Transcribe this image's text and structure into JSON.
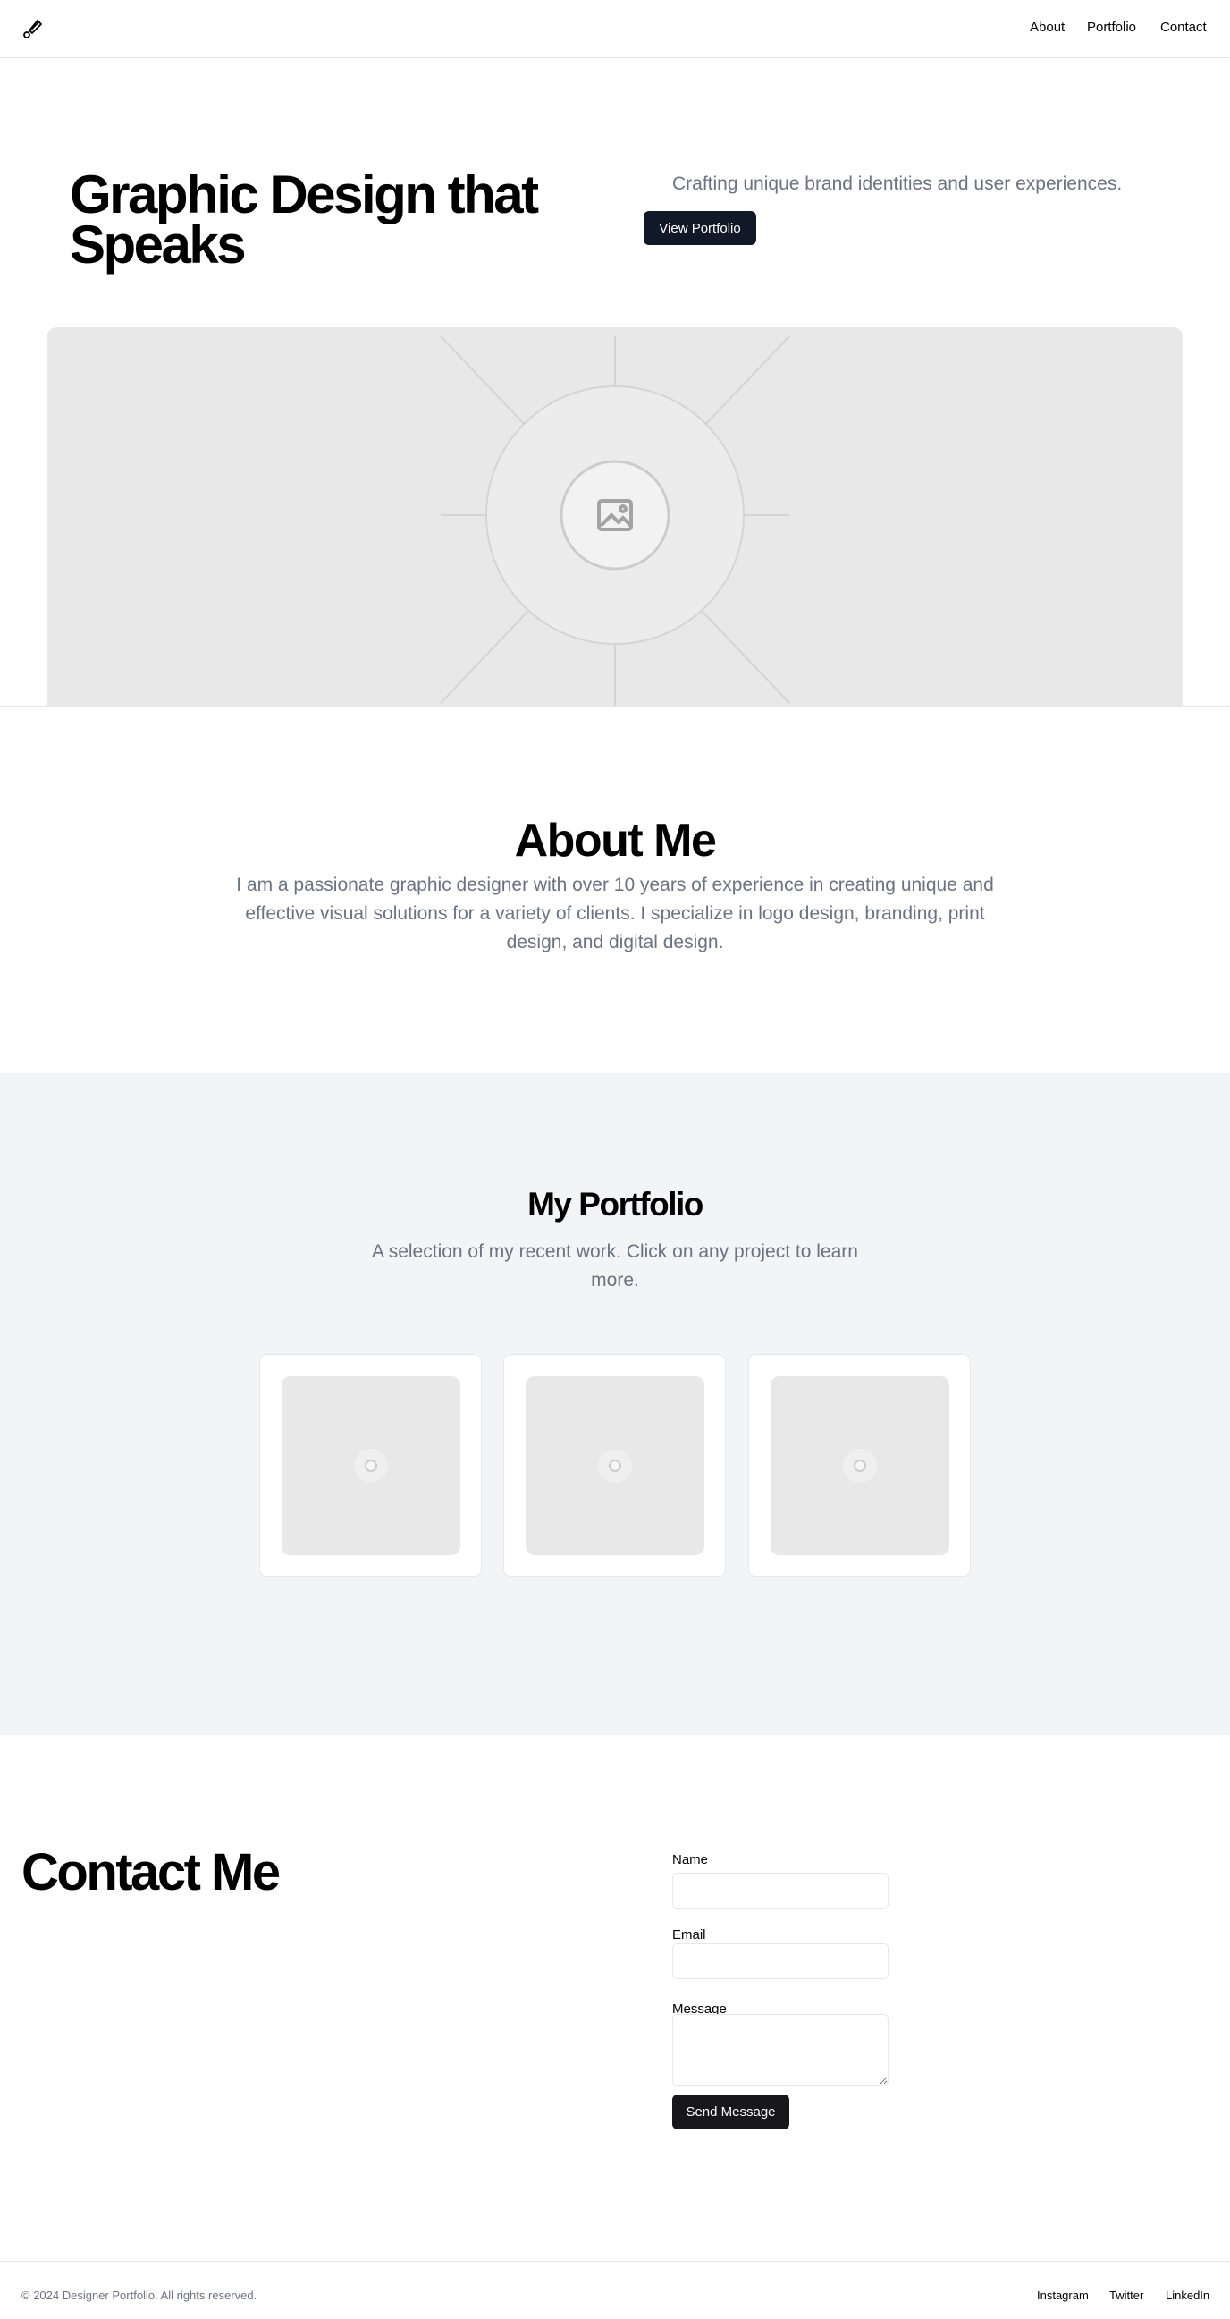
{
  "nav": {
    "links": [
      "About",
      "Portfolio",
      "Contact"
    ]
  },
  "hero": {
    "title": "Graphic Design that Speaks",
    "tagline": "Crafting unique brand identities and user experiences.",
    "button": "View Portfolio"
  },
  "about": {
    "title": "About Me",
    "text": "I am a passionate graphic designer with over 10 years of experience in creating unique and effective visual solutions for a variety of clients. I specialize in logo design, branding, print design, and digital design."
  },
  "portfolio": {
    "title": "My Portfolio",
    "subtitle": "A selection of my recent work. Click on any project to learn more."
  },
  "contact": {
    "title": "Contact Me",
    "name_label": "Name",
    "email_label": "Email",
    "message_label": "Message",
    "button": "Send Message"
  },
  "footer": {
    "copyright": "© 2024 Designer Portfolio. All rights reserved.",
    "links": [
      "Instagram",
      "Twitter",
      "LinkedIn"
    ]
  },
  "colors": {
    "primary_button": "#111827",
    "send_button": "#18181b",
    "muted_text": "#6b7280"
  }
}
